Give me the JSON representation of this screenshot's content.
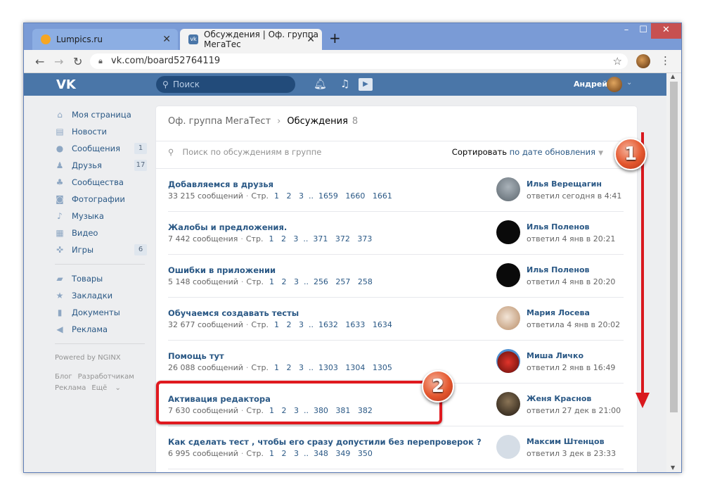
{
  "browser": {
    "tabs": [
      {
        "title": "Lumpics.ru",
        "active": false
      },
      {
        "title": "Обсуждения | Оф. группа МегаТес",
        "active": true
      }
    ],
    "url": "vk.com/board52764119"
  },
  "vk_header": {
    "search_placeholder": "Поиск",
    "user_name": "Андрей"
  },
  "sidebar": {
    "items": [
      {
        "label": "Моя страница",
        "icon": "home-icon",
        "count": ""
      },
      {
        "label": "Новости",
        "icon": "news-icon",
        "count": ""
      },
      {
        "label": "Сообщения",
        "icon": "messages-icon",
        "count": "1"
      },
      {
        "label": "Друзья",
        "icon": "friends-icon",
        "count": "17"
      },
      {
        "label": "Сообщества",
        "icon": "communities-icon",
        "count": ""
      },
      {
        "label": "Фотографии",
        "icon": "photos-icon",
        "count": ""
      },
      {
        "label": "Музыка",
        "icon": "music-icon",
        "count": ""
      },
      {
        "label": "Видео",
        "icon": "video-icon",
        "count": ""
      },
      {
        "label": "Игры",
        "icon": "games-icon",
        "count": "6"
      }
    ],
    "items2": [
      {
        "label": "Товары",
        "icon": "goods-icon"
      },
      {
        "label": "Закладки",
        "icon": "bookmarks-icon"
      },
      {
        "label": "Документы",
        "icon": "documents-icon"
      },
      {
        "label": "Реклама",
        "icon": "ads-icon"
      }
    ],
    "powered": "Powered by NGINX",
    "footer_links": [
      "Блог",
      "Разработчикам",
      "Реклама",
      "Ещё"
    ]
  },
  "board": {
    "group": "Оф. группа МегаТест",
    "section": "Обсуждения",
    "count": "8",
    "search_placeholder": "Поиск по обсуждениям в группе",
    "sort_prefix": "Сортировать",
    "sort_value": "по дате обновления",
    "topics": [
      {
        "title": "Добавляемся в друзья",
        "messages": "33 215 сообщений",
        "pages_label": "Стр.",
        "pages": "1   2   3  ..  1659   1660   1661",
        "author": "Илья Верещагин",
        "when": "ответил сегодня в 4:41",
        "avatar_color": "#7f8a93"
      },
      {
        "title": "Жалобы и предложения.",
        "messages": "7 442 сообщения",
        "pages_label": "Стр.",
        "pages": "1   2   3  ..  371   372   373",
        "author": "Илья Поленов",
        "when": "ответил 4 янв в 20:21",
        "avatar_color": "#0a0a0a"
      },
      {
        "title": "Ошибки в приложении",
        "messages": "5 148 сообщений",
        "pages_label": "Стр.",
        "pages": "1   2   3  ..  256   257   258",
        "author": "Илья Поленов",
        "when": "ответил 4 янв в 20:20",
        "avatar_color": "#0a0a0a"
      },
      {
        "title": "Обучаемся создавать тесты",
        "messages": "32 677 сообщений",
        "pages_label": "Стр.",
        "pages": "1   2   3  ..  1632   1633   1634",
        "author": "Мария Лосева",
        "when": "ответила 4 янв в 20:02",
        "avatar_color": "#d9b59a"
      },
      {
        "title": "Помощь тут",
        "messages": "26 088 сообщений",
        "pages_label": "Стр.",
        "pages": "1   2   3  ..  1303   1304   1305",
        "author": "Миша Личко",
        "when": "ответил 2 янв в 16:49",
        "avatar_color": "#c8322a"
      },
      {
        "title": "Активация редактора",
        "messages": "7 630 сообщений",
        "pages_label": "Стр.",
        "pages": "1   2   3  ..  380   381   382",
        "author": "Женя Краснов",
        "when": "ответил 27 дек в 21:00",
        "avatar_color": "#3b3027"
      },
      {
        "title": "Как сделать тест , чтобы его сразу допустили без перепроверок ?",
        "messages": "6 995 сообщений",
        "pages_label": "Стр.",
        "pages": "1   2   3  ..  348   349   350",
        "author": "Максим Штенцов",
        "when": "ответил 3 дек в 23:33",
        "avatar_color": "#d5dde6"
      }
    ]
  },
  "annotations": {
    "badge1": "1",
    "badge2": "2"
  }
}
